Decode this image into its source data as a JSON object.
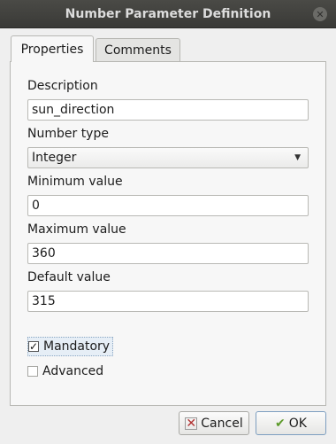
{
  "window": {
    "title": "Number Parameter Definition"
  },
  "tabs": [
    {
      "label": "Properties",
      "active": true
    },
    {
      "label": "Comments",
      "active": false
    }
  ],
  "form": {
    "description_label": "Description",
    "description_value": "sun_direction",
    "number_type_label": "Number type",
    "number_type_value": "Integer",
    "minimum_label": "Minimum value",
    "minimum_value": "0",
    "maximum_label": "Maximum value",
    "maximum_value": "360",
    "default_label": "Default value",
    "default_value": "315",
    "mandatory_label": "Mandatory",
    "mandatory_checked": true,
    "advanced_label": "Advanced",
    "advanced_checked": false
  },
  "buttons": {
    "cancel_label": "Cancel",
    "ok_label": "OK"
  }
}
